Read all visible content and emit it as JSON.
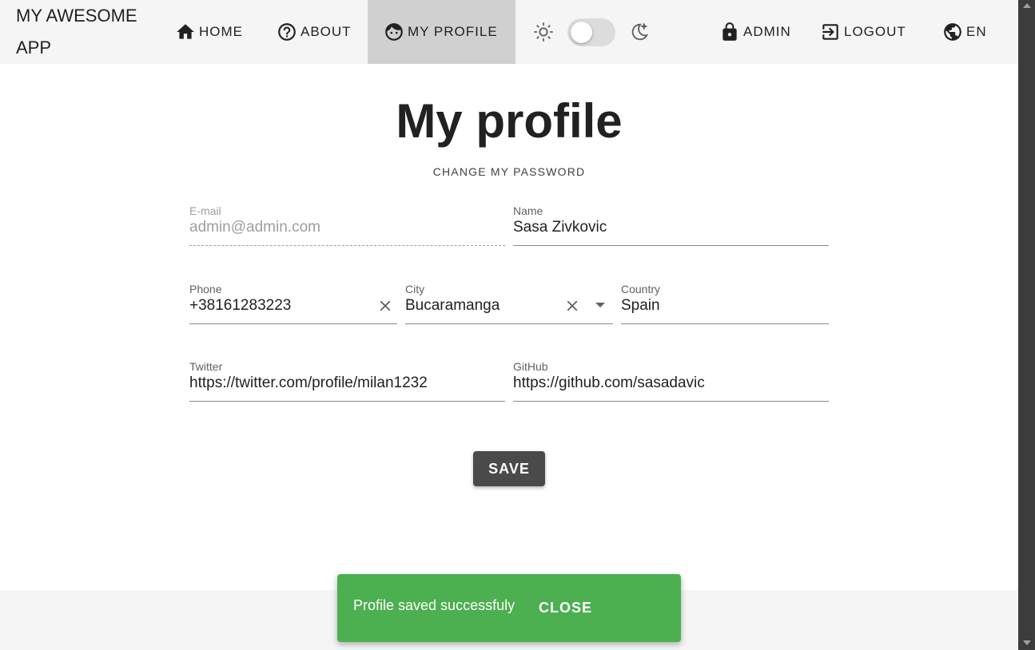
{
  "app": {
    "brand": "MY AWESOME APP"
  },
  "nav": {
    "home": "HOME",
    "about": "ABOUT",
    "profile": "MY PROFILE",
    "admin": "ADMIN",
    "logout": "LOGOUT",
    "language": "EN"
  },
  "theme": {
    "dark_mode_on": false
  },
  "page": {
    "title": "My profile",
    "change_password": "CHANGE MY PASSWORD"
  },
  "form": {
    "email": {
      "label": "E-mail",
      "value": "admin@admin.com",
      "disabled": true
    },
    "name": {
      "label": "Name",
      "value": "Sasa Zivkovic"
    },
    "phone": {
      "label": "Phone",
      "value": "+38161283223"
    },
    "city": {
      "label": "City",
      "value": "Bucaramanga"
    },
    "country": {
      "label": "Country",
      "value": "Spain"
    },
    "twitter": {
      "label": "Twitter",
      "value": "https://twitter.com/profile/milan1232"
    },
    "github": {
      "label": "GitHub",
      "value": "https://github.com/sasadavic"
    },
    "save_label": "SAVE"
  },
  "snackbar": {
    "message": "Profile saved successfuly",
    "close_label": "CLOSE",
    "color": "#4caf50"
  },
  "icons": {
    "home": "home-icon",
    "about": "help-circle-icon",
    "profile": "face-icon",
    "admin": "lock-icon",
    "logout": "logout-icon",
    "language": "globe-icon",
    "light": "sun-icon",
    "dark": "moon-icon"
  }
}
